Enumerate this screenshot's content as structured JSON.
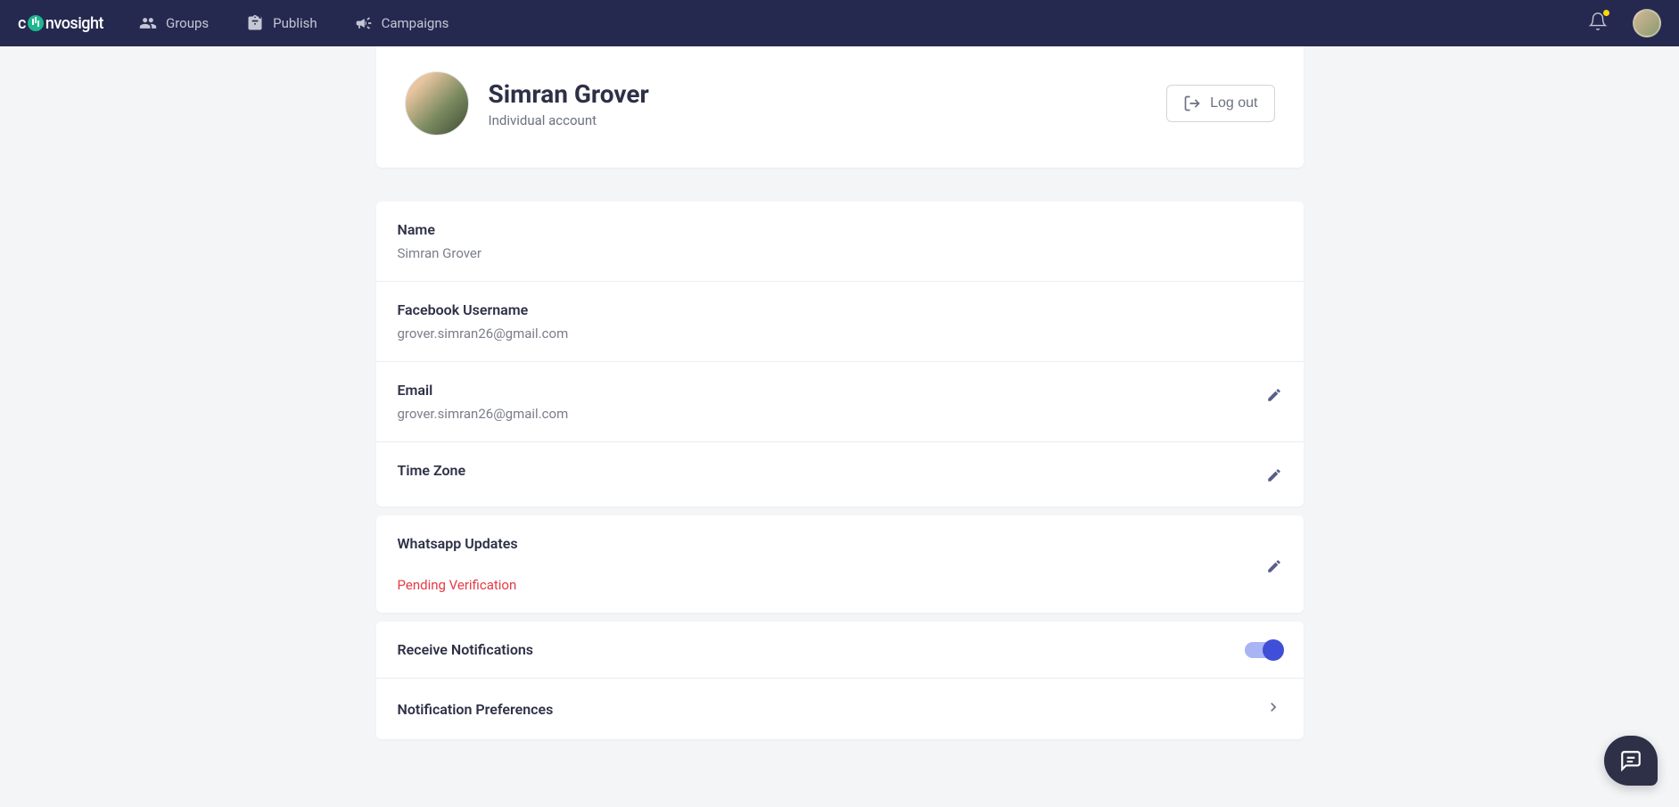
{
  "logo": {
    "text_before": "c",
    "text_after": "nvosight"
  },
  "nav": {
    "groups": "Groups",
    "publish": "Publish",
    "campaigns": "Campaigns"
  },
  "profile": {
    "name": "Simran Grover",
    "subtitle": "Individual account",
    "logout_label": "Log out"
  },
  "settings": {
    "name": {
      "label": "Name",
      "value": "Simran Grover"
    },
    "facebook_username": {
      "label": "Facebook Username",
      "value": "grover.simran26@gmail.com"
    },
    "email": {
      "label": "Email",
      "value": "grover.simran26@gmail.com"
    },
    "timezone": {
      "label": "Time Zone",
      "value": ""
    },
    "whatsapp": {
      "label": "Whatsapp Updates",
      "status": "Pending Verification"
    },
    "notifications": {
      "receive_label": "Receive Notifications",
      "preferences_label": "Notification Preferences"
    }
  }
}
